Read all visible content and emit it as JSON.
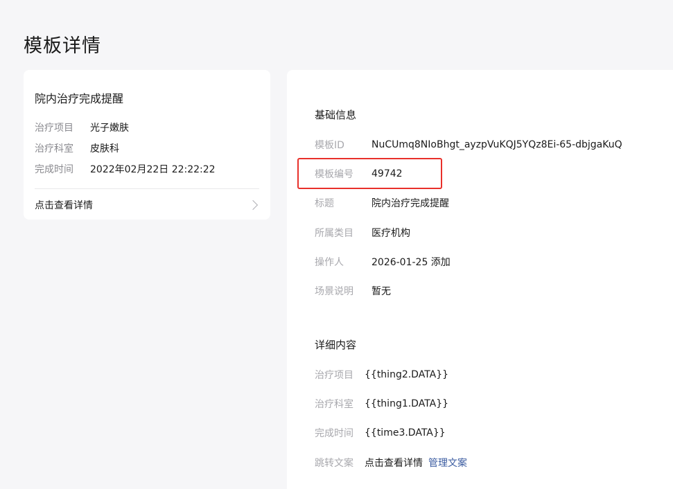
{
  "page": {
    "title": "模板详情"
  },
  "preview": {
    "title": "院内治疗完成提醒",
    "rows": [
      {
        "label": "治疗项目",
        "value": "光子嫩肤"
      },
      {
        "label": "治疗科室",
        "value": "皮肤科"
      },
      {
        "label": "完成时间",
        "value": "2022年02月22日 22:22:22"
      }
    ],
    "link_label": "点击查看详情"
  },
  "basic": {
    "section_title": "基础信息",
    "rows": [
      {
        "label": "模板ID",
        "value": "NuCUmq8NIoBhgt_ayzpVuKQJ5YQz8Ei-65-dbjgaKuQ"
      },
      {
        "label": "模板编号",
        "value": "49742"
      },
      {
        "label": "标题",
        "value": "院内治疗完成提醒"
      },
      {
        "label": "所属类目",
        "value": "医疗机构"
      },
      {
        "label": "操作人",
        "value": "2026-01-25 添加"
      },
      {
        "label": "场景说明",
        "value": "暂无"
      }
    ]
  },
  "detail": {
    "section_title": "详细内容",
    "rows": [
      {
        "label": "治疗项目",
        "value": "{{thing2.DATA}}"
      },
      {
        "label": "治疗科室",
        "value": "{{thing1.DATA}}"
      },
      {
        "label": "完成时间",
        "value": "{{time3.DATA}}"
      },
      {
        "label": "跳转文案",
        "value": "点击查看详情",
        "link": "管理文案"
      }
    ]
  },
  "colors": {
    "highlight": "#e8302a",
    "link": "#3a5ba0"
  }
}
